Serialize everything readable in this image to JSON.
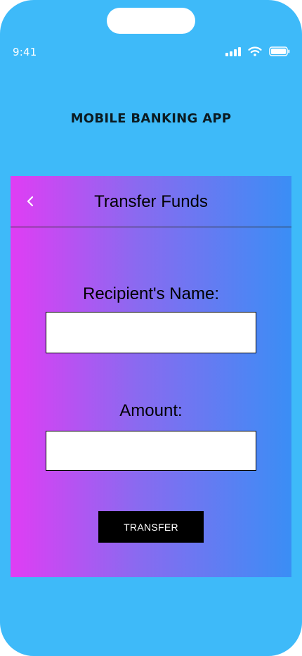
{
  "status_bar": {
    "time": "9:41",
    "icons": [
      "signal-bars-icon",
      "wifi-icon",
      "battery-icon"
    ]
  },
  "app": {
    "title": "MOBILE BANKING APP"
  },
  "screen": {
    "header": {
      "title": "Transfer Funds",
      "back_icon": "chevron-left-icon"
    },
    "form": {
      "recipient_label": "Recipient's Name:",
      "recipient_value": "",
      "amount_label": "Amount:",
      "amount_value": "",
      "submit_label": "TRANSFER"
    }
  },
  "colors": {
    "phone_background": "#3ebaf9",
    "card_gradient_start": "#e03df4",
    "card_gradient_end": "#3a8ef5",
    "button_background": "#000000",
    "button_text": "#ffffff"
  }
}
